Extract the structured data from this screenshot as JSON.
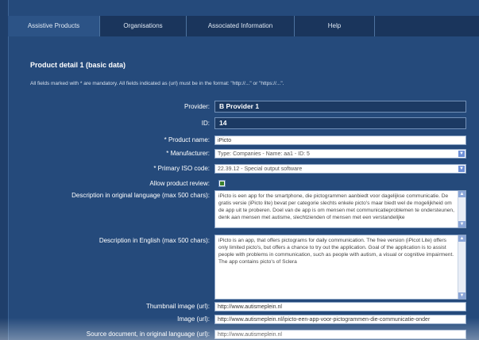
{
  "tabs": [
    {
      "label": "Assistive Products"
    },
    {
      "label": "Organisations"
    },
    {
      "label": "Associated Information"
    },
    {
      "label": "Help"
    },
    {
      "label": ""
    }
  ],
  "title": "Product detail 1 (basic data)",
  "note": "All fields marked with * are mandatory. All fields indicated as (url) must be in the format: \"http://...\" or \"https://...\".",
  "fields": {
    "provider": {
      "label": "Provider:",
      "value": "B Provider 1"
    },
    "id": {
      "label": "ID:",
      "value": "14"
    },
    "product_name": {
      "label": "* Product name:",
      "value": "iPicto"
    },
    "manufacturer": {
      "label": "* Manufacturer:",
      "value": "Type: Companies - Name: aa1 - ID: 5"
    },
    "primary_iso": {
      "label": "* Primary ISO code:",
      "value": "22.39.12 - Special output software"
    },
    "allow_review": {
      "label": "Allow product review:",
      "checked": true
    },
    "desc_original": {
      "label": "Description in original language (max 500 chars):",
      "value": "iPicto is een app for the smartphone, die pictogrammen aanbiedt voor dagelijkse communicatie. De gratis versie (iPicto lite) bevat per categorie slechts enkele picto's maar biedt wel de mogelijkheid om de app uit te proberen. Doel van de app is om mensen met communicatieproblemen te ondersteunen, denk aan mensen met autisme, slechtzienden of mensen met een verstandelijke"
    },
    "desc_english": {
      "label": "Description in English (max 500 chars):",
      "value": "iPicto is an app, that offers pictograms for daily communication. The free version (iPicot Lite) offers only limited picto's, but offers a chance to try out the application. Goal of the application is to assist people with problems in communication, such as people with autism, a visual or cognitive impairment. The app contains picto's of Sclera"
    },
    "thumbnail": {
      "label": "Thumbnail image (url):",
      "value": "http://www.autismeplein.nl"
    },
    "image": {
      "label": "Image (url):",
      "value": "http://www.autismeplein.nl/ipicto-een-app-voor-pictogrammen-die-communicatie-onder"
    },
    "source_doc": {
      "label": "Source document, in original language (url):",
      "value": "http://www.autismeplein.nl"
    }
  },
  "colors": {
    "background": "#254a7b",
    "tab_bar": "#1a355c",
    "accent": "#6d8fd6"
  }
}
